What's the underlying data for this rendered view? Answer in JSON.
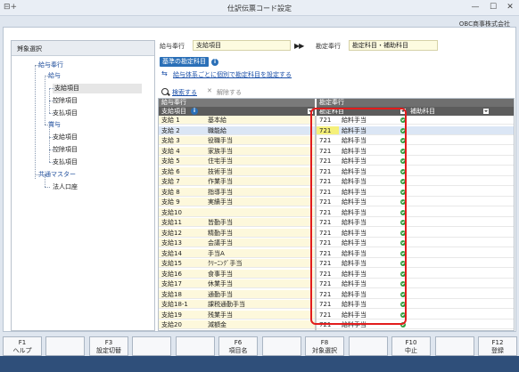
{
  "window": {
    "title": "仕訳伝票コード設定",
    "app_icon": "⊟+",
    "min_glyph": "—",
    "max_glyph": "☐",
    "close_glyph": "✕"
  },
  "company": "OBC商事株式会社",
  "left_pane": {
    "title": "対象選択",
    "collapse_glyph": "<",
    "tree": [
      {
        "label": "給与奉行",
        "kind": "group"
      },
      {
        "label": "給与",
        "kind": "group"
      },
      {
        "label": "支給項目",
        "kind": "item",
        "selected": true
      },
      {
        "label": "控除項目",
        "kind": "item"
      },
      {
        "label": "支払項目",
        "kind": "item"
      },
      {
        "label": "賞与",
        "kind": "group"
      },
      {
        "label": "支給項目",
        "kind": "item"
      },
      {
        "label": "控除項目",
        "kind": "item"
      },
      {
        "label": "支払項目",
        "kind": "item"
      },
      {
        "label": "共通マスター",
        "kind": "group"
      },
      {
        "label": "法人口座",
        "kind": "item"
      }
    ]
  },
  "top": {
    "source_label": "給与奉行",
    "source_value": "支給項目",
    "arrows": "▶▶",
    "target_label": "勘定奉行",
    "target_value": "勘定科目・補助科目",
    "badge": "基準の勘定科目",
    "info_glyph": "i",
    "link_setting": "給与体系ごとに個別で勘定科目を設定する",
    "link_glyph": "⇆",
    "search_label": "検索する",
    "clear_label": "解除する",
    "clear_glyph": "✕"
  },
  "grid": {
    "group_left": "給与奉行",
    "group_right": "勘定奉行",
    "col_item": "支給項目",
    "col_account": "勘定科目",
    "col_sub": "補助科目",
    "rows": [
      {
        "code": "支給 1",
        "name": "基本給",
        "acode": "721",
        "aname": "給料手当",
        "sub": ""
      },
      {
        "code": "支給 2",
        "name": "職能給",
        "acode": "721",
        "aname": "給料手当",
        "sub": "",
        "selected": true
      },
      {
        "code": "支給 3",
        "name": "役職手当",
        "acode": "721",
        "aname": "給料手当",
        "sub": ""
      },
      {
        "code": "支給 4",
        "name": "家族手当",
        "acode": "721",
        "aname": "給料手当",
        "sub": ""
      },
      {
        "code": "支給 5",
        "name": "住宅手当",
        "acode": "721",
        "aname": "給料手当",
        "sub": ""
      },
      {
        "code": "支給 6",
        "name": "技術手当",
        "acode": "721",
        "aname": "給料手当",
        "sub": ""
      },
      {
        "code": "支給 7",
        "name": "作業手当",
        "acode": "721",
        "aname": "給料手当",
        "sub": ""
      },
      {
        "code": "支給 8",
        "name": "指導手当",
        "acode": "721",
        "aname": "給料手当",
        "sub": ""
      },
      {
        "code": "支給 9",
        "name": "実績手当",
        "acode": "721",
        "aname": "給料手当",
        "sub": ""
      },
      {
        "code": "支給10",
        "name": "",
        "acode": "721",
        "aname": "給料手当",
        "sub": ""
      },
      {
        "code": "支給11",
        "name": "皆勤手当",
        "acode": "721",
        "aname": "給料手当",
        "sub": ""
      },
      {
        "code": "支給12",
        "name": "精勤手当",
        "acode": "721",
        "aname": "給料手当",
        "sub": ""
      },
      {
        "code": "支給13",
        "name": "会議手当",
        "acode": "721",
        "aname": "給料手当",
        "sub": ""
      },
      {
        "code": "支給14",
        "name": "手当A",
        "acode": "721",
        "aname": "給料手当",
        "sub": ""
      },
      {
        "code": "支給15",
        "name": "ｸﾘｰﾆﾝｸﾞ手当",
        "acode": "721",
        "aname": "給料手当",
        "sub": ""
      },
      {
        "code": "支給16",
        "name": "食事手当",
        "acode": "721",
        "aname": "給料手当",
        "sub": ""
      },
      {
        "code": "支給17",
        "name": "休業手当",
        "acode": "721",
        "aname": "給料手当",
        "sub": ""
      },
      {
        "code": "支給18",
        "name": "通勤手当",
        "acode": "721",
        "aname": "給料手当",
        "sub": ""
      },
      {
        "code": "支給18-1",
        "name": "課税通勤手当",
        "acode": "721",
        "aname": "給料手当",
        "sub": ""
      },
      {
        "code": "支給19",
        "name": "残業手当",
        "acode": "721",
        "aname": "給料手当",
        "sub": ""
      },
      {
        "code": "支給20",
        "name": "減額金",
        "acode": "721",
        "aname": "給料手当",
        "sub": ""
      }
    ]
  },
  "fkeys": [
    {
      "key": "F1",
      "label": "ヘルプ"
    },
    {
      "key": "",
      "label": ""
    },
    {
      "key": "F3",
      "label": "設定切替"
    },
    {
      "key": "",
      "label": ""
    },
    {
      "key": "",
      "label": ""
    },
    {
      "key": "F6",
      "label": "項目名"
    },
    {
      "key": "",
      "label": ""
    },
    {
      "key": "F8",
      "label": "対象選択"
    },
    {
      "key": "",
      "label": ""
    },
    {
      "key": "F10",
      "label": "中止"
    },
    {
      "key": "",
      "label": ""
    },
    {
      "key": "F12",
      "label": "登録"
    }
  ],
  "colors": {
    "accent": "#2a6fb7",
    "highlight": "#e21c1c",
    "ok": "#2e9d3c"
  }
}
